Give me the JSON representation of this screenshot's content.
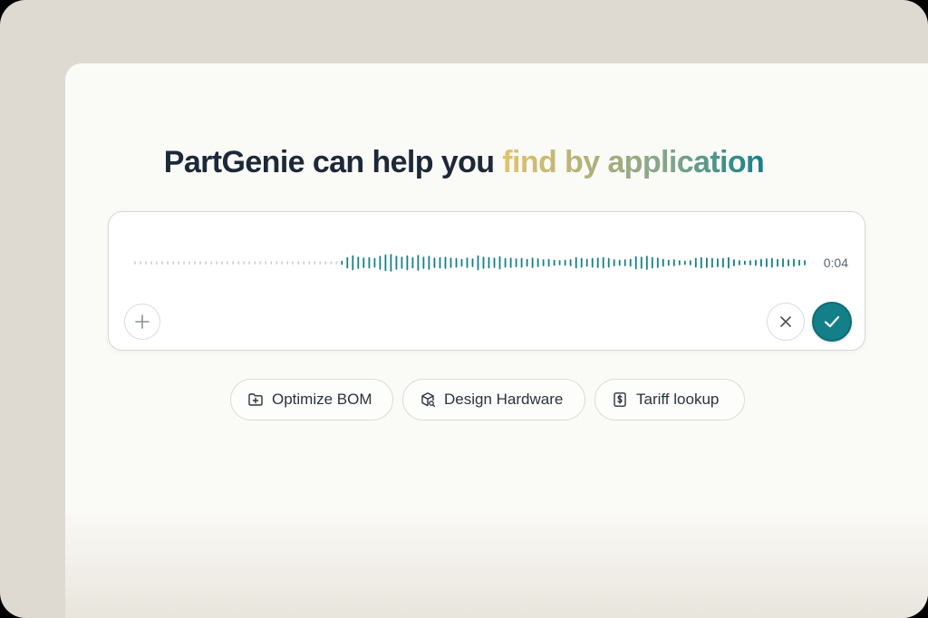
{
  "headline": {
    "prefix": "PartGenie can help you ",
    "accent": "find by application"
  },
  "recorder": {
    "timer": "0:04",
    "waveform_levels": [
      0.1,
      0.1,
      0.1,
      0.1,
      0.1,
      0.1,
      0.1,
      0.1,
      0.1,
      0.1,
      0.1,
      0.1,
      0.1,
      0.1,
      0.1,
      0.1,
      0.1,
      0.1,
      0.1,
      0.1,
      0.1,
      0.1,
      0.1,
      0.1,
      0.1,
      0.1,
      0.1,
      0.1,
      0.1,
      0.1,
      0.1,
      0.1,
      0.1,
      0.1,
      0.1,
      0.1,
      0.1,
      0.1,
      0.15,
      0.55,
      0.75,
      0.6,
      0.5,
      0.55,
      0.45,
      0.7,
      0.85,
      0.9,
      0.7,
      0.6,
      0.75,
      0.55,
      0.8,
      0.6,
      0.7,
      0.5,
      0.55,
      0.6,
      0.5,
      0.45,
      0.35,
      0.5,
      0.4,
      0.75,
      0.6,
      0.55,
      0.5,
      0.65,
      0.45,
      0.5,
      0.4,
      0.45,
      0.35,
      0.5,
      0.4,
      0.3,
      0.35,
      0.25,
      0.2,
      0.25,
      0.3,
      0.55,
      0.45,
      0.35,
      0.45,
      0.5,
      0.55,
      0.45,
      0.3,
      0.25,
      0.3,
      0.35,
      0.65,
      0.6,
      0.7,
      0.55,
      0.5,
      0.35,
      0.25,
      0.3,
      0.2,
      0.15,
      0.2,
      0.45,
      0.55,
      0.5,
      0.45,
      0.4,
      0.45,
      0.55,
      0.3,
      0.2,
      0.15,
      0.2,
      0.25,
      0.35,
      0.4,
      0.45,
      0.35,
      0.4,
      0.3,
      0.35,
      0.25,
      0.2
    ],
    "active_color": "#137f89",
    "idle_color": "#cfd3d6"
  },
  "actions": {
    "add_icon": "plus-icon",
    "cancel_icon": "close-icon",
    "confirm_icon": "check-icon"
  },
  "chips": [
    {
      "label": "Optimize BOM",
      "icon": "folder-plus-icon"
    },
    {
      "label": "Design Hardware",
      "icon": "package-search-icon"
    },
    {
      "label": "Tariff lookup",
      "icon": "dollar-receipt-icon"
    }
  ],
  "colors": {
    "brand_teal": "#137f89",
    "headline_text": "#1d2838",
    "accent_gradient": [
      "#e1c46a",
      "#16808a"
    ]
  }
}
